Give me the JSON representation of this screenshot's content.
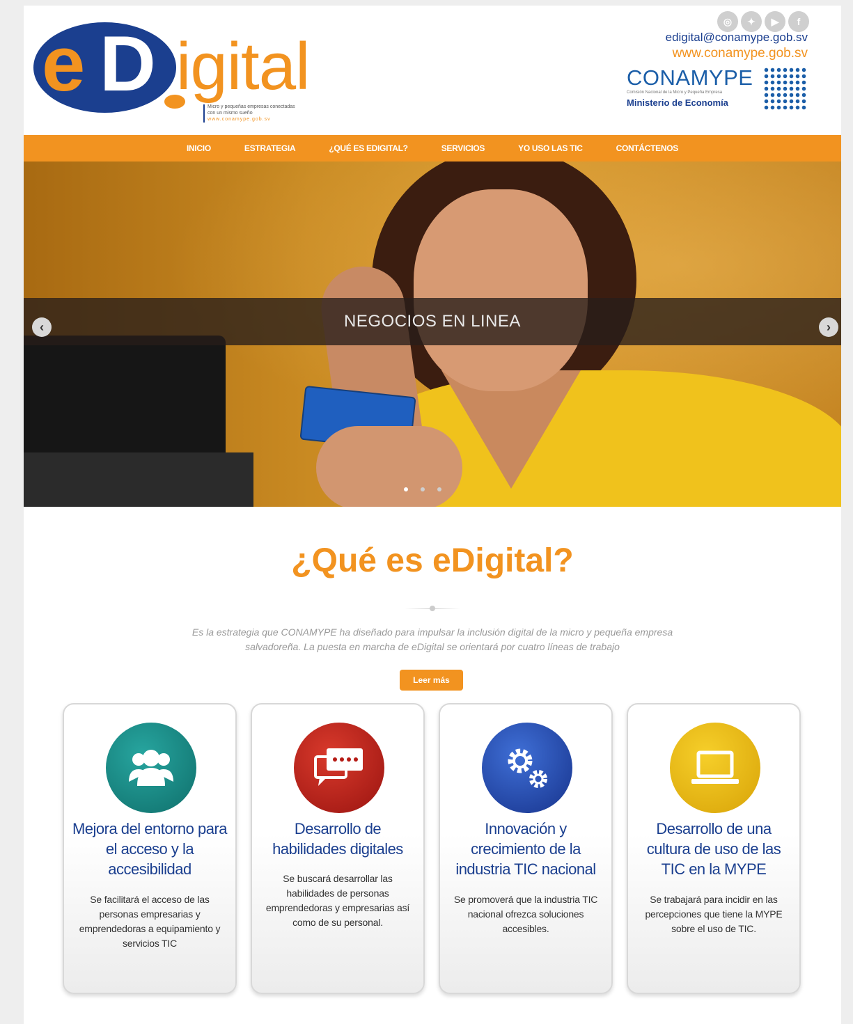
{
  "header": {
    "logo": {
      "e": "e",
      "d": "D",
      "rest": "igital",
      "tagline": "Micro y pequeñas empresas conectadas con un mismo sueño",
      "web": "www.conamype.gob.sv"
    },
    "social_icons": [
      "instagram-icon",
      "twitter-icon",
      "youtube-icon",
      "facebook-icon"
    ],
    "email": "edigital@conamype.gob.sv",
    "website": "www.conamype.gob.sv",
    "conamype": {
      "name": "CONAMYPE",
      "subtitle": "Comisión Nacional de la Micro y Pequeña Empresa",
      "ministry": "Ministerio de Economía"
    }
  },
  "nav": {
    "items": [
      "INICIO",
      "ESTRATEGIA",
      "¿QUÉ ES EDIGITAL?",
      "SERVICIOS",
      "YO USO LAS TIC",
      "CONTÁCTENOS"
    ]
  },
  "slider": {
    "caption": "NEGOCIOS EN LINEA",
    "prev_icon": "arrow-left-icon",
    "next_icon": "arrow-right-icon",
    "slide_count": 3,
    "active_index": 0
  },
  "section": {
    "title": "¿Qué es eDigital?",
    "intro": "Es la estrategia que CONAMYPE ha diseñado para impulsar la inclusión digital de la micro y pequeña empresa salvadoreña. La puesta en marcha de eDigital se orientará por cuatro líneas de trabajo",
    "button": "Leer más"
  },
  "cards": [
    {
      "icon": "people-icon",
      "title": "Mejora del entorno para el acceso y la accesibilidad",
      "text": "Se facilitará el acceso de las personas empresarias y emprendedoras a equipamiento y servicios TIC"
    },
    {
      "icon": "chat-icon",
      "title": "Desarrollo de habilidades digitales",
      "text": "Se buscará desarrollar las habilidades de personas emprendedoras y empresarias así como de su personal."
    },
    {
      "icon": "gears-icon",
      "title": "Innovación y crecimiento de la industria TIC nacional",
      "text": "Se promoverá que la industria TIC nacional ofrezca soluciones accesibles."
    },
    {
      "icon": "laptop-icon",
      "title": "Desarrollo de una cultura de uso de las TIC en la MYPE",
      "text": "Se trabajará para incidir en las percepciones que tiene la MYPE sobre el uso de TIC."
    }
  ],
  "colors": {
    "orange": "#f29320",
    "navy": "#1b3f8f",
    "teal": "#1a8c87",
    "red": "#c0201a",
    "blue": "#2a55b8",
    "yellow": "#e9b914"
  }
}
